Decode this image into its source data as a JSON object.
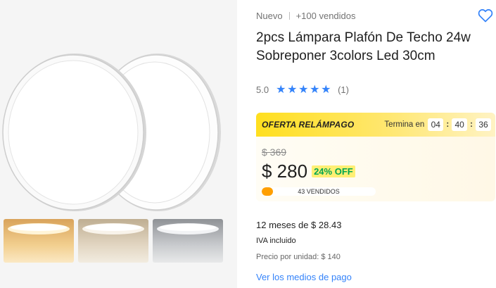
{
  "product": {
    "condition": "Nuevo",
    "sold": "+100 vendidos",
    "title": "2pcs Lámpara Plafón De Techo 24w Sobreponer 3colors Led 30cm",
    "rating_value": "5.0",
    "rating_stars": 5,
    "rating_count": "(1)",
    "favorite_icon": "heart-outline-icon"
  },
  "deal": {
    "label": "OFERTA RELÁMPAGO",
    "ends_label": "Termina en",
    "hours": "04",
    "minutes": "40",
    "seconds": "36",
    "time_separator": ":",
    "old_price": "$ 369",
    "price": "$ 280",
    "discount": "24% OFF",
    "sold_label": "43 VENDIDOS",
    "sold_progress": 0.1
  },
  "purchase": {
    "installments": "12 meses de $ 28.43",
    "tax": "IVA incluido",
    "unit_price": "Precio por unidad: $ 140",
    "payment_link": "Ver los medios de pago"
  },
  "gallery": {
    "thumbnails": [
      "warm-light",
      "neutral-light",
      "cool-light"
    ]
  },
  "colors": {
    "accent": "#3483fa",
    "deal_yellow": "#ffdf1f",
    "discount_green": "#00a650",
    "progress_orange": "#ff9f00"
  }
}
